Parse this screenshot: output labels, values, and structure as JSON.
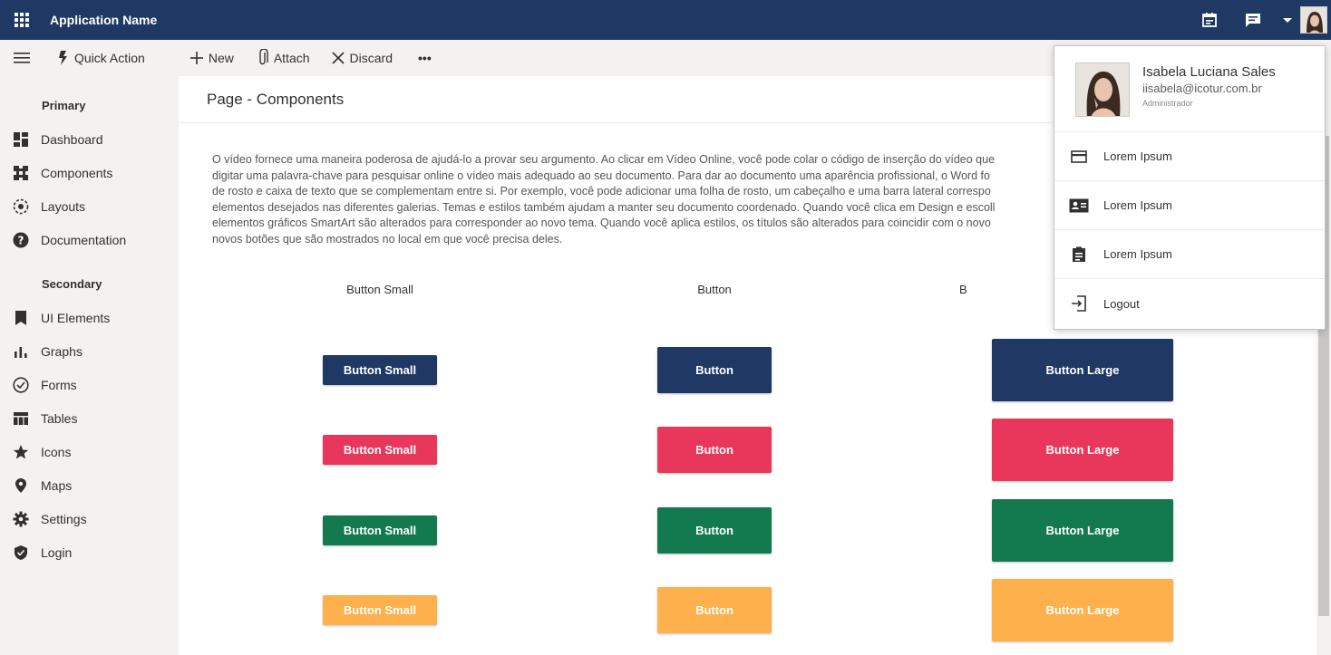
{
  "topbar": {
    "app_name": "Application Name",
    "icons": [
      "waffle-icon",
      "calendar-icon",
      "chat-icon",
      "caret-down-icon",
      "avatar"
    ]
  },
  "commandbar": {
    "quick_action": "Quick Action",
    "new": "New",
    "attach": "Attach",
    "discard": "Discard",
    "more": "•••"
  },
  "sidebar": {
    "primary_header": "Primary",
    "primary_items": [
      {
        "label": "Dashboard",
        "icon": "dashboard-icon"
      },
      {
        "label": "Components",
        "icon": "components-icon"
      },
      {
        "label": "Layouts",
        "icon": "layouts-icon"
      },
      {
        "label": "Documentation",
        "icon": "help-icon"
      }
    ],
    "secondary_header": "Secondary",
    "secondary_items": [
      {
        "label": "UI Elements",
        "icon": "bookmark-icon"
      },
      {
        "label": "Graphs",
        "icon": "bar-chart-icon"
      },
      {
        "label": "Forms",
        "icon": "check-circle-icon"
      },
      {
        "label": "Tables",
        "icon": "table-icon"
      },
      {
        "label": "Icons",
        "icon": "star-icon"
      },
      {
        "label": "Maps",
        "icon": "map-pin-icon"
      },
      {
        "label": "Settings",
        "icon": "gear-icon"
      },
      {
        "label": "Login",
        "icon": "shield-icon"
      }
    ]
  },
  "main": {
    "title": "Page - Components",
    "paragraph_lines": [
      "O vídeo fornece uma maneira poderosa de ajudá-lo a provar seu argumento. Ao clicar em Vídeo Online, você pode colar o código de inserção do vídeo que",
      "digitar uma palavra-chave para pesquisar online o vídeo mais adequado ao seu documento. Para dar ao documento uma aparência profissional, o Word fo",
      "de rosto e caixa de texto que se complementam entre si. Por exemplo, você pode adicionar uma folha de rosto, um cabeçalho e uma barra lateral correspo",
      "elementos desejados nas diferentes galerias. Temas e estilos também ajudam a manter seu documento coordenado. Quando você clica em Design e escoll",
      "elementos gráficos SmartArt são alterados para corresponder ao novo tema. Quando você aplica estilos, os títulos são alterados para coincidir com o novo",
      "novos botões que são mostrados no local em que você precisa deles."
    ],
    "column_labels": [
      "Button Small",
      "Button",
      "B"
    ],
    "button_rows": [
      {
        "color": "#1f3864",
        "small": "Button Small",
        "medium": "Button",
        "large": "Button Large"
      },
      {
        "color": "#e8375a",
        "small": "Button Small",
        "medium": "Button",
        "large": "Button Large"
      },
      {
        "color": "#137a4f",
        "small": "Button Small",
        "medium": "Button",
        "large": "Button Large"
      },
      {
        "color": "#fdb04b",
        "small": "Button Small",
        "medium": "Button",
        "large": "Button Large"
      }
    ]
  },
  "user_menu": {
    "name": "Isabela Luciana Sales",
    "email": "iisabela@icotur.com.br",
    "role": "Administrador",
    "items": [
      {
        "label": "Lorem Ipsum",
        "icon": "card-icon"
      },
      {
        "label": "Lorem Ipsum",
        "icon": "id-card-icon"
      },
      {
        "label": "Lorem Ipsum",
        "icon": "clipboard-icon"
      },
      {
        "label": "Logout",
        "icon": "logout-icon"
      }
    ]
  },
  "colors": {
    "brand": "#1f3864",
    "danger": "#e8375a",
    "success": "#137a4f",
    "warning": "#fdb04b"
  }
}
